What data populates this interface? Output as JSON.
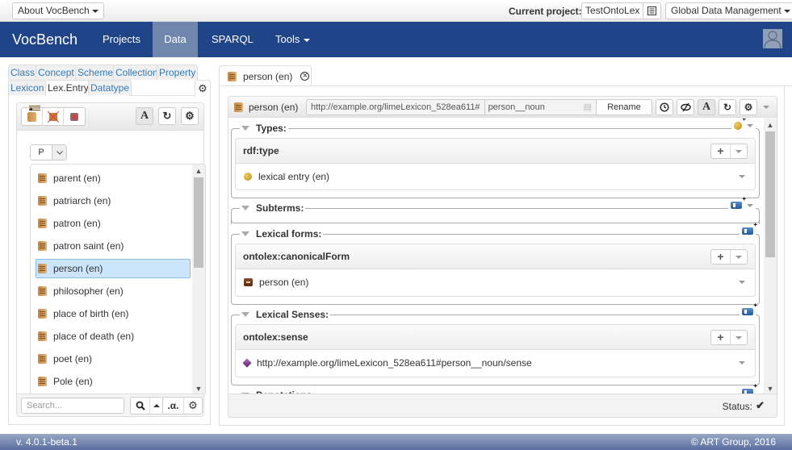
{
  "topbar": {
    "about_label": "About VocBench",
    "current_project_label": "Current project:",
    "current_project_value": "TestOntoLex",
    "global_data_label": "Global Data Management"
  },
  "navbar": {
    "brand": "VocBench",
    "items": [
      {
        "label": "Projects",
        "active": false
      },
      {
        "label": "Data",
        "active": true
      },
      {
        "label": "SPARQL",
        "active": false
      },
      {
        "label": "Tools",
        "active": false,
        "dropdown": true
      }
    ]
  },
  "left_panel": {
    "tabs_row1": [
      "Class",
      "Concept",
      "Scheme",
      "Collection",
      "Property"
    ],
    "tabs_row2": [
      "Lexicon",
      "Lex.Entry",
      "Datatype"
    ],
    "active_tab": "Lex.Entry",
    "toolbar_icons": [
      "create-lexical-entry-icon",
      "delete-lexical-entry-icon",
      "deprecate-lexical-entry-icon"
    ],
    "rendering_button": "A",
    "letter_selector": "P",
    "entries": [
      {
        "label": "parent (en)",
        "selected": false
      },
      {
        "label": "patriarch (en)",
        "selected": false
      },
      {
        "label": "patron (en)",
        "selected": false
      },
      {
        "label": "patron saint (en)",
        "selected": false
      },
      {
        "label": "person (en)",
        "selected": true
      },
      {
        "label": "philosopher (en)",
        "selected": false
      },
      {
        "label": "place of birth (en)",
        "selected": false
      },
      {
        "label": "place of death (en)",
        "selected": false
      },
      {
        "label": "poet (en)",
        "selected": false
      },
      {
        "label": "Pole (en)",
        "selected": false
      }
    ],
    "search_placeholder": "Search...",
    "alpha_button": ".α."
  },
  "resource_view": {
    "tab_label": "person (en)",
    "header_label": "person (en)",
    "iri_namespace": "http://example.org/limeLexicon_528ea611#",
    "iri_localname": "person__noun",
    "rename_label": "Rename",
    "rendering_button": "A",
    "sections": [
      {
        "title": "Types:",
        "tool_icon": "add-type-icon",
        "predicate": "rdf:type",
        "values": [
          {
            "label": "lexical entry (en)",
            "icon": "class-icon"
          }
        ]
      },
      {
        "title": "Subterms:",
        "tool_icon": "add-subterm-icon"
      },
      {
        "title": "Lexical forms:",
        "tool_icon": "add-form-icon",
        "predicate": "ontolex:canonicalForm",
        "values": [
          {
            "label": "person (en)",
            "icon": "form-icon"
          }
        ]
      },
      {
        "title": "Lexical Senses:",
        "tool_icon": "add-sense-icon",
        "predicate": "ontolex:sense",
        "values": [
          {
            "label": "http://example.org/limeLexicon_528ea611#person__noun/sense",
            "icon": "sense-icon"
          }
        ]
      },
      {
        "title": "Denotations:"
      }
    ],
    "status_label": "Status:"
  },
  "footer": {
    "version": "v. 4.0.1-beta.1",
    "copyright": "© ART Group, 2016"
  }
}
